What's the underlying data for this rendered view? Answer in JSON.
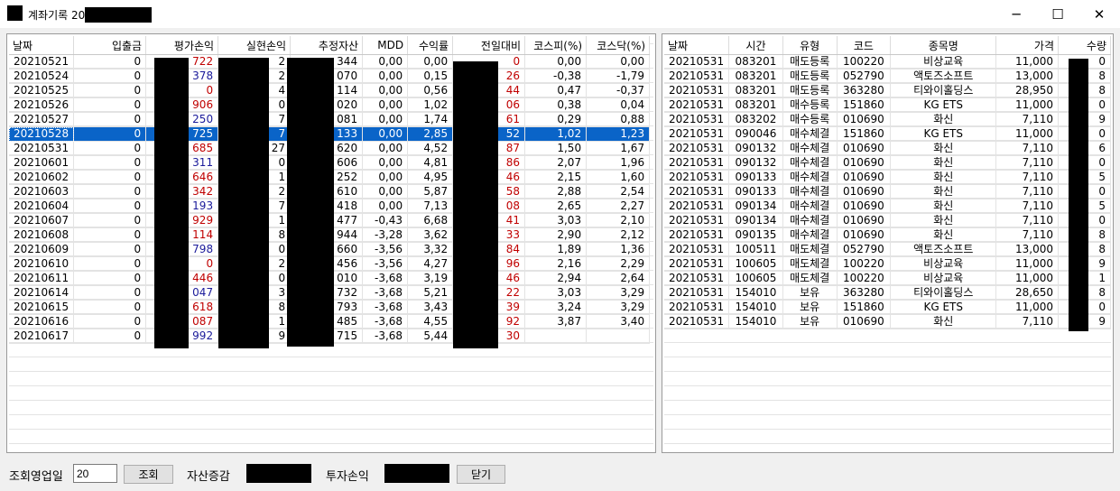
{
  "window": {
    "title": "계좌기록 20",
    "minimize_glyph": "─",
    "maximize_glyph": "☐",
    "close_glyph": "✕"
  },
  "left_table": {
    "headers": [
      "날짜",
      "입출금",
      "평가손익",
      "실현손익",
      "추정자산",
      "MDD",
      "수익률",
      "전일대비",
      "코스피(%)",
      "코스닥(%)"
    ],
    "selected_row": 5,
    "rows": [
      [
        "20210521",
        "0",
        "722",
        "2",
        "344",
        "0,00",
        "0,00",
        "0",
        "0,00",
        "0,00"
      ],
      [
        "20210524",
        "0",
        "378",
        "2",
        "070",
        "0,00",
        "0,15",
        "26",
        "-0,38",
        "-1,79"
      ],
      [
        "20210525",
        "0",
        "0",
        "4",
        "114",
        "0,00",
        "0,56",
        "44",
        "0,47",
        "-0,37"
      ],
      [
        "20210526",
        "0",
        "906",
        "0",
        "020",
        "0,00",
        "1,02",
        "06",
        "0,38",
        "0,04"
      ],
      [
        "20210527",
        "0",
        "250",
        "7",
        "081",
        "0,00",
        "1,74",
        "61",
        "0,29",
        "0,88"
      ],
      [
        "20210528",
        "0",
        "725",
        "7",
        "133",
        "0,00",
        "2,85",
        "52",
        "1,02",
        "1,23"
      ],
      [
        "20210531",
        "0",
        "685",
        "27",
        "620",
        "0,00",
        "4,52",
        "87",
        "1,50",
        "1,67"
      ],
      [
        "20210601",
        "0",
        "311",
        "0",
        "606",
        "0,00",
        "4,81",
        "86",
        "2,07",
        "1,96"
      ],
      [
        "20210602",
        "0",
        "646",
        "1",
        "252",
        "0,00",
        "4,95",
        "46",
        "2,15",
        "1,60"
      ],
      [
        "20210603",
        "0",
        "342",
        "2",
        "610",
        "0,00",
        "5,87",
        "58",
        "2,88",
        "2,54"
      ],
      [
        "20210604",
        "0",
        "193",
        "7",
        "418",
        "0,00",
        "7,13",
        "08",
        "2,65",
        "2,27"
      ],
      [
        "20210607",
        "0",
        "929",
        "1",
        "477",
        "-0,43",
        "6,68",
        "41",
        "3,03",
        "2,10"
      ],
      [
        "20210608",
        "0",
        "114",
        "8",
        "944",
        "-3,28",
        "3,62",
        "33",
        "2,90",
        "2,12"
      ],
      [
        "20210609",
        "0",
        "798",
        "0",
        "660",
        "-3,56",
        "3,32",
        "84",
        "1,89",
        "1,36"
      ],
      [
        "20210610",
        "0",
        "0",
        "2",
        "456",
        "-3,56",
        "4,27",
        "96",
        "2,16",
        "2,29"
      ],
      [
        "20210611",
        "0",
        "446",
        "0",
        "010",
        "-3,68",
        "3,19",
        "46",
        "2,94",
        "2,64"
      ],
      [
        "20210614",
        "0",
        "047",
        "3",
        "732",
        "-3,68",
        "5,21",
        "22",
        "3,03",
        "3,29"
      ],
      [
        "20210615",
        "0",
        "618",
        "8",
        "793",
        "-3,68",
        "3,43",
        "39",
        "3,24",
        "3,29"
      ],
      [
        "20210616",
        "0",
        "087",
        "1",
        "485",
        "-3,68",
        "4,55",
        "92",
        "3,87",
        "3,40"
      ],
      [
        "20210617",
        "0",
        "992",
        "9",
        "715",
        "-3,68",
        "5,44",
        "30",
        "",
        ""
      ]
    ]
  },
  "right_table": {
    "headers": [
      "날짜",
      "시간",
      "유형",
      "코드",
      "종목명",
      "가격",
      "수량"
    ],
    "rows": [
      [
        "20210531",
        "083201",
        "매도등록",
        "100220",
        "비상교육",
        "11,000",
        "0"
      ],
      [
        "20210531",
        "083201",
        "매도등록",
        "052790",
        "액토즈소프트",
        "13,000",
        "8"
      ],
      [
        "20210531",
        "083201",
        "매도등록",
        "363280",
        "티와이홀딩스",
        "28,950",
        "8"
      ],
      [
        "20210531",
        "083201",
        "매수등록",
        "151860",
        "KG ETS",
        "11,000",
        "0"
      ],
      [
        "20210531",
        "083202",
        "매수등록",
        "010690",
        "화신",
        "7,110",
        "9"
      ],
      [
        "20210531",
        "090046",
        "매수체결",
        "151860",
        "KG ETS",
        "11,000",
        "0"
      ],
      [
        "20210531",
        "090132",
        "매수체결",
        "010690",
        "화신",
        "7,110",
        "6"
      ],
      [
        "20210531",
        "090132",
        "매수체결",
        "010690",
        "화신",
        "7,110",
        "0"
      ],
      [
        "20210531",
        "090133",
        "매수체결",
        "010690",
        "화신",
        "7,110",
        "5"
      ],
      [
        "20210531",
        "090133",
        "매수체결",
        "010690",
        "화신",
        "7,110",
        "0"
      ],
      [
        "20210531",
        "090134",
        "매수체결",
        "010690",
        "화신",
        "7,110",
        "5"
      ],
      [
        "20210531",
        "090134",
        "매수체결",
        "010690",
        "화신",
        "7,110",
        "0"
      ],
      [
        "20210531",
        "090135",
        "매수체결",
        "010690",
        "화신",
        "7,110",
        "8"
      ],
      [
        "20210531",
        "100511",
        "매도체결",
        "052790",
        "액토즈소프트",
        "13,000",
        "8"
      ],
      [
        "20210531",
        "100605",
        "매도체결",
        "100220",
        "비상교육",
        "11,000",
        "9"
      ],
      [
        "20210531",
        "100605",
        "매도체결",
        "100220",
        "비상교육",
        "11,000",
        "1"
      ],
      [
        "20210531",
        "154010",
        "보유",
        "363280",
        "티와이홀딩스",
        "28,650",
        "8"
      ],
      [
        "20210531",
        "154010",
        "보유",
        "151860",
        "KG ETS",
        "11,000",
        "0"
      ],
      [
        "20210531",
        "154010",
        "보유",
        "010690",
        "화신",
        "7,110",
        "9"
      ]
    ]
  },
  "bottom": {
    "days_label": "조회영업일",
    "days_value": "20",
    "query_button": "조회",
    "asset_change_label": "자산증감",
    "invest_pnl_label": "투자손익",
    "close_button": "닫기"
  },
  "colors": {
    "selection": "#0a64c8",
    "positive": "#c00000",
    "negative": "#1a1a9a"
  }
}
